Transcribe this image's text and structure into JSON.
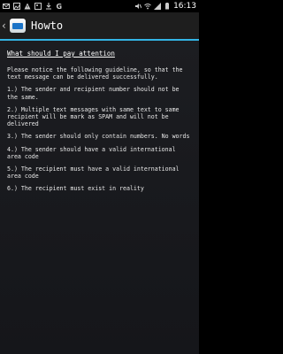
{
  "status_bar": {
    "time": "16:13",
    "icons": [
      "email-icon",
      "image-icon",
      "warning-icon",
      "image-icon",
      "download-icon",
      "google-icon",
      "mute-icon",
      "wifi-icon",
      "signal-icon",
      "battery-icon"
    ]
  },
  "action_bar": {
    "title": "Howto"
  },
  "content": {
    "heading": "What should I pay attention",
    "intro": "Please notice the following guideline, so that the text message can be delivered successfully.",
    "items": [
      "1.) The sender and recipient number should not be the same.",
      "2.) Multiple text messages with same text to same recipient will be mark as SPAM and will not be delivered",
      "3.) The sender should only contain numbers. No words",
      "4.) The sender should have a valid international area code",
      "5.) The recipient must have a valid international area code",
      "6.) The recipient must exist in reality"
    ]
  },
  "colors": {
    "accent": "#33b5e5",
    "background": "#1c1d21"
  }
}
